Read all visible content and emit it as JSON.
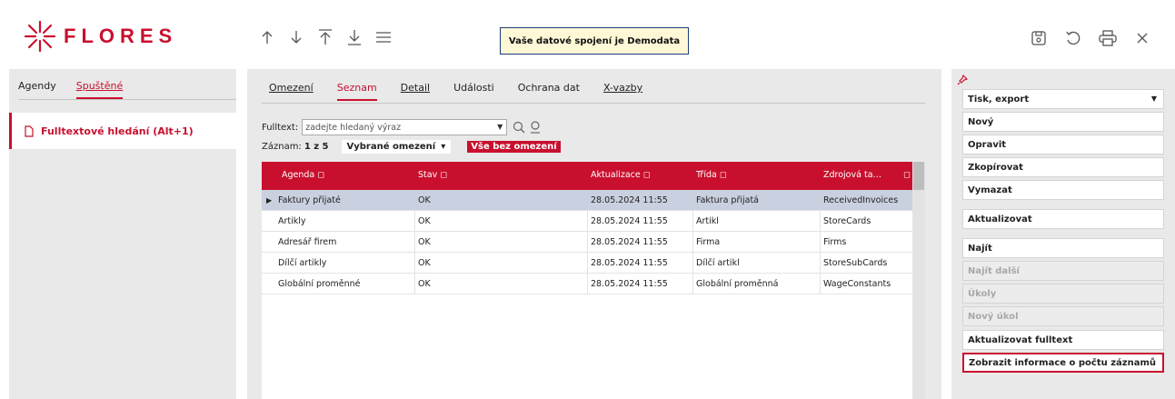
{
  "brand": {
    "logo_text": "FLORES",
    "accent": "#c8102e"
  },
  "toolbar": {
    "nav_icons": [
      "arrow-up-icon",
      "arrow-down-icon",
      "jump-top-icon",
      "jump-bottom-icon",
      "menu-icon"
    ],
    "connection": "Vaše datové spojení je Demodata",
    "right_icons": [
      "save-icon",
      "refresh-icon",
      "print-icon",
      "close-icon"
    ]
  },
  "left": {
    "tabs": [
      "Agendy",
      "Spuštěné"
    ],
    "active_tab": "Spuštěné",
    "item": "Fulltextové hledání (Alt+1)"
  },
  "center": {
    "tabs": [
      "Omezení",
      "Seznam",
      "Detail",
      "Události",
      "Ochrana dat",
      "X-vazby"
    ],
    "active_tab": "Seznam",
    "fulltext_label": "Fulltext:",
    "fulltext_placeholder": "zadejte hledaný výraz",
    "records_label": "Záznam:",
    "records_count": "1 z 5",
    "filter_selected": "Vybrané omezení",
    "filter_all": "Vše bez omezení",
    "columns": [
      "Agenda",
      "Stav",
      "Aktualizace",
      "Třída",
      "Zdrojová ta…"
    ],
    "rows": [
      {
        "agenda": "Faktury přijaté",
        "stav": "OK",
        "aktualizace": "28.05.2024 11:55",
        "trida": "Faktura přijatá",
        "zdroj": "ReceivedInvoices",
        "selected": true
      },
      {
        "agenda": "Artikly",
        "stav": "OK",
        "aktualizace": "28.05.2024 11:55",
        "trida": "Artikl",
        "zdroj": "StoreCards",
        "selected": false
      },
      {
        "agenda": "Adresář firem",
        "stav": "OK",
        "aktualizace": "28.05.2024 11:55",
        "trida": "Firma",
        "zdroj": "Firms",
        "selected": false
      },
      {
        "agenda": "Dílčí artikly",
        "stav": "OK",
        "aktualizace": "28.05.2024 11:55",
        "trida": "Dílčí artikl",
        "zdroj": "StoreSubCards",
        "selected": false
      },
      {
        "agenda": "Globální proměnné",
        "stav": "OK",
        "aktualizace": "28.05.2024 11:55",
        "trida": "Globální proměnná",
        "zdroj": "WageConstants",
        "selected": false
      }
    ]
  },
  "right": {
    "buttons": [
      {
        "label": "Tisk, export",
        "disabled": false,
        "dropdown": true
      },
      {
        "label": "Nový",
        "disabled": false
      },
      {
        "label": "Opravit",
        "disabled": false
      },
      {
        "label": "Zkopírovat",
        "disabled": false
      },
      {
        "label": "Vymazat",
        "disabled": false
      },
      {
        "label": "Aktualizovat",
        "disabled": false
      },
      {
        "label": "Najít",
        "disabled": false
      },
      {
        "label": "Najít další",
        "disabled": true
      },
      {
        "label": "Úkoly",
        "disabled": true
      },
      {
        "label": "Nový úkol",
        "disabled": true
      },
      {
        "label": "Aktualizovat fulltext",
        "disabled": false
      },
      {
        "label": "Zobrazit informace o počtu záznamů",
        "disabled": false,
        "highlighted": true
      }
    ]
  }
}
